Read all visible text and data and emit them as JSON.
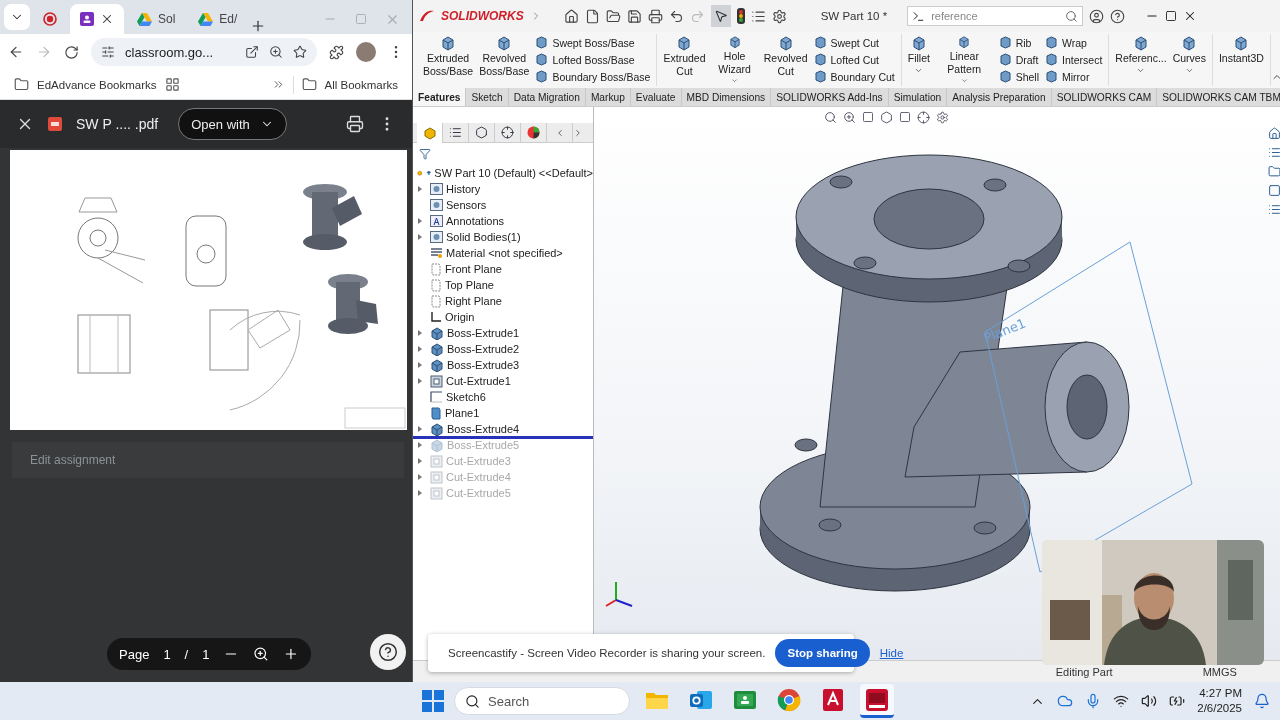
{
  "browser": {
    "tabs": [
      {
        "kind": "recording",
        "selected": false
      },
      {
        "kind": "classroom",
        "selected": true
      },
      {
        "kind": "drive",
        "label": "Sol",
        "selected": false
      },
      {
        "kind": "drive",
        "label": "Ed/",
        "selected": false
      }
    ],
    "address": "classroom.go...",
    "bookmarks": [
      {
        "label": "EdAdvance Bookmarks"
      }
    ],
    "all_bookmarks": "All Bookmarks",
    "pdf": {
      "file_name": "SW P .... .pdf",
      "open_with": "Open with",
      "assignment_title": "Edit assignment",
      "page_label": "Page",
      "page_current": "1",
      "page_separator": "/",
      "page_total": "1"
    }
  },
  "solidworks": {
    "brand": "SOLIDWORKS",
    "title": "SW Part 10 *",
    "search_value": "reference",
    "ribbon": [
      {
        "items": [
          {
            "kind": "big",
            "label": "Extruded\nBoss/Base",
            "dropdown": false
          },
          {
            "kind": "big",
            "label": "Revolved\nBoss/Base",
            "dropdown": false
          },
          {
            "kind": "stack",
            "items": [
              {
                "label": "Swept Boss/Base"
              },
              {
                "label": "Lofted Boss/Base"
              },
              {
                "label": "Boundary Boss/Base"
              }
            ]
          }
        ]
      },
      {
        "items": [
          {
            "kind": "big",
            "label": "Extruded\nCut",
            "dropdown": false
          },
          {
            "kind": "big",
            "label": "Hole Wizard",
            "dropdown": true
          },
          {
            "kind": "big",
            "label": "Revolved\nCut",
            "dropdown": false
          },
          {
            "kind": "stack",
            "items": [
              {
                "label": "Swept Cut"
              },
              {
                "label": "Lofted Cut"
              },
              {
                "label": "Boundary Cut"
              }
            ]
          }
        ]
      },
      {
        "items": [
          {
            "kind": "big",
            "label": "Fillet",
            "dropdown": true
          },
          {
            "kind": "big",
            "label": "Linear Pattern",
            "dropdown": true
          },
          {
            "kind": "stack",
            "items": [
              {
                "label": "Rib"
              },
              {
                "label": "Draft"
              },
              {
                "label": "Shell"
              }
            ]
          },
          {
            "kind": "stack",
            "items": [
              {
                "label": "Wrap"
              },
              {
                "label": "Intersect"
              },
              {
                "label": "Mirror"
              }
            ]
          }
        ]
      },
      {
        "items": [
          {
            "kind": "big",
            "label": "Referenc...",
            "dropdown": true
          },
          {
            "kind": "big",
            "label": "Curves",
            "dropdown": true
          }
        ]
      },
      {
        "items": [
          {
            "kind": "big",
            "label": "Instant3D",
            "dropdown": false
          }
        ]
      }
    ],
    "tabs": [
      {
        "label": "Features",
        "selected": true
      },
      {
        "label": "Sketch",
        "selected": false
      },
      {
        "label": "Data Migration",
        "selected": false
      },
      {
        "label": "Markup",
        "selected": false
      },
      {
        "label": "Evaluate",
        "selected": false
      },
      {
        "label": "MBD Dimensions",
        "selected": false
      },
      {
        "label": "SOLIDWORKS Add-Ins",
        "selected": false
      },
      {
        "label": "Simulation",
        "selected": false
      },
      {
        "label": "Analysis Preparation",
        "selected": false
      },
      {
        "label": "SOLIDWORKS CAM",
        "selected": false
      },
      {
        "label": "SOLIDWORKS CAM TBM",
        "selected": false
      }
    ],
    "tree": {
      "root": "SW Part 10 (Default) <<Default>",
      "items": [
        {
          "kind": "history",
          "label": "History",
          "expandable": true,
          "suppressed": false
        },
        {
          "kind": "sensors",
          "label": "Sensors",
          "expandable": false,
          "suppressed": false
        },
        {
          "kind": "annotations",
          "label": "Annotations",
          "expandable": true,
          "suppressed": false
        },
        {
          "kind": "bodies",
          "label": "Solid Bodies(1)",
          "expandable": true,
          "suppressed": false
        },
        {
          "kind": "material",
          "label": "Material <not specified>",
          "expandable": false,
          "suppressed": false
        },
        {
          "kind": "plane",
          "label": "Front Plane",
          "expandable": false,
          "suppressed": false
        },
        {
          "kind": "plane",
          "label": "Top Plane",
          "expandable": false,
          "suppressed": false
        },
        {
          "kind": "plane",
          "label": "Right Plane",
          "expandable": false,
          "suppressed": false
        },
        {
          "kind": "origin",
          "label": "Origin",
          "expandable": false,
          "suppressed": false
        },
        {
          "kind": "boss",
          "label": "Boss-Extrude1",
          "expandable": true,
          "suppressed": false
        },
        {
          "kind": "boss",
          "label": "Boss-Extrude2",
          "expandable": true,
          "suppressed": false
        },
        {
          "kind": "boss",
          "label": "Boss-Extrude3",
          "expandable": true,
          "suppressed": false
        },
        {
          "kind": "cut",
          "label": "Cut-Extrude1",
          "expandable": true,
          "suppressed": false
        },
        {
          "kind": "sketch",
          "label": "Sketch6",
          "expandable": false,
          "suppressed": false
        },
        {
          "kind": "refplane",
          "label": "Plane1",
          "expandable": false,
          "suppressed": false
        },
        {
          "kind": "boss",
          "label": "Boss-Extrude4",
          "expandable": true,
          "suppressed": false
        },
        {
          "kind": "rollback"
        },
        {
          "kind": "boss",
          "label": "Boss-Extrude5",
          "expandable": true,
          "suppressed": true
        },
        {
          "kind": "cut",
          "label": "Cut-Extrude3",
          "expandable": true,
          "suppressed": true
        },
        {
          "kind": "cut",
          "label": "Cut-Extrude4",
          "expandable": true,
          "suppressed": true
        },
        {
          "kind": "cut",
          "label": "Cut-Extrude5",
          "expandable": true,
          "suppressed": true
        }
      ]
    },
    "plane_label": "Plane1",
    "status": {
      "mode": "Editing Part",
      "units": "MMGS"
    }
  },
  "notification": {
    "message": "Screencastify - Screen Video Recorder is sharing your screen.",
    "stop": "Stop sharing",
    "hide": "Hide"
  },
  "taskbar": {
    "search_placeholder": "Search",
    "apps": [
      {
        "kind": "explorer",
        "selected": false
      },
      {
        "kind": "outlook",
        "selected": false
      },
      {
        "kind": "classroom",
        "selected": false
      },
      {
        "kind": "chrome",
        "selected": false
      },
      {
        "kind": "autocad",
        "selected": false
      },
      {
        "kind": "solidworks",
        "selected": true
      }
    ],
    "time": "4:27 PM",
    "date": "2/6/2025"
  }
}
